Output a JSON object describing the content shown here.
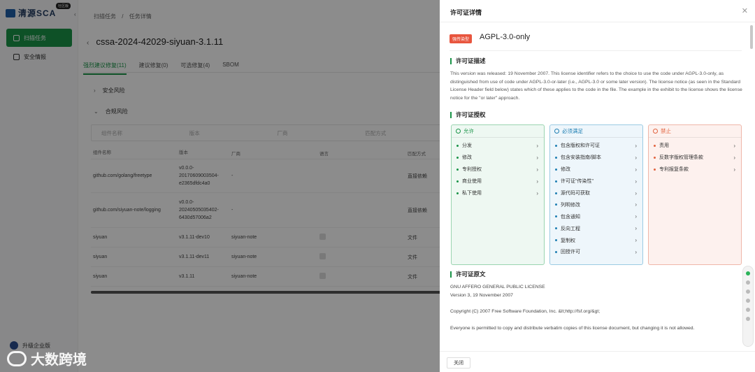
{
  "app": {
    "logo_text": "清源SCA",
    "logo_badge": "社区版",
    "nav": [
      {
        "label": "扫描任务",
        "active": true
      },
      {
        "label": "安全情报",
        "active": false
      }
    ],
    "upgrade_label": "升级企业版"
  },
  "main": {
    "breadcrumb": [
      "扫描任务",
      "/",
      "任务详情"
    ],
    "title": "cssa-2024-42029-siyuan-3.1.11",
    "tabs": [
      {
        "label": "强烈建议修复(11)",
        "active": true
      },
      {
        "label": "建议修复(0)",
        "active": false
      },
      {
        "label": "可选修复(4)",
        "active": false
      },
      {
        "label": "SBOM",
        "active": false
      }
    ],
    "sections": [
      "安全风险",
      "合规风险"
    ],
    "filters": [
      "组件名称",
      "版本",
      "厂商",
      "匹配方式"
    ],
    "table": {
      "headers": [
        "组件名称",
        "版本",
        "厂商",
        "语言",
        "匹配方式"
      ],
      "rows": [
        {
          "name": "github.com/golang/freetype",
          "version": "v0.0.0-20170609003504-e2365dfdc4a0",
          "vendor": "-",
          "method": "直接依赖"
        },
        {
          "name": "github.com/siyuan-note/logging",
          "version": "v0.0.0-20240505035402-6430d57006a2",
          "vendor": "-",
          "method": "直接依赖"
        },
        {
          "name": "siyuan",
          "version": "v3.1.11-dev10",
          "vendor": "siyuan-note",
          "method": "文件"
        },
        {
          "name": "siyuan",
          "version": "v3.1.11-dev11",
          "vendor": "siyuan-note",
          "method": "文件"
        },
        {
          "name": "siyuan",
          "version": "v3.1.11",
          "vendor": "siyuan-note",
          "method": "文件"
        }
      ]
    }
  },
  "drawer": {
    "title": "许可证详情",
    "risk_tag": "强传染型",
    "license_name": "AGPL-3.0-only",
    "desc_heading": "许可证描述",
    "description": "This version was released: 19 November 2007. This license identifier refers to the choice to use the code under AGPL-3.0-only, as distinguished from use of code under AGPL-3.0-or-later (i.e., AGPL-3.0 or some later version). The license notice (as seen in the Standard License Header field below) states which of these applies to the code in the file. The example in the exhibit to the license shows the license notice for the \"or later\" approach.",
    "grant_heading": "许可证授权",
    "allow": {
      "title": "允许",
      "items": [
        "分发",
        "修改",
        "专利授权",
        "商业使用",
        "私下使用"
      ]
    },
    "must": {
      "title": "必须满足",
      "items": [
        "包含版权和许可证",
        "包含安装指南/脚本",
        "修改",
        "许可证\"传染性\"",
        "源代码可获取",
        "列明修改",
        "包含通知",
        "反向工程",
        "复制权",
        "回授许可"
      ]
    },
    "forbid": {
      "title": "禁止",
      "items": [
        "责用",
        "反数字版权管理条款",
        "专利报复条款"
      ]
    },
    "orig_heading": "许可证原文",
    "orig_lines": [
      "GNU AFFERO GENERAL PUBLIC LICENSE",
      "Version 3, 19 November 2007",
      "Copyright (C) 2007 Free Software Foundation, Inc. &lt;http://fsf.org/&gt;",
      "Everyone is permitted to copy and distribute verbatim copies of this license document, but changing it is not allowed."
    ],
    "close_label": "关闭"
  },
  "watermark": "大数跨境",
  "colors": {
    "brand_green": "#1a9448",
    "risk_red": "#e8553e",
    "allow": "#1a9448",
    "must": "#1f7fb3",
    "forbid": "#e2643f"
  }
}
